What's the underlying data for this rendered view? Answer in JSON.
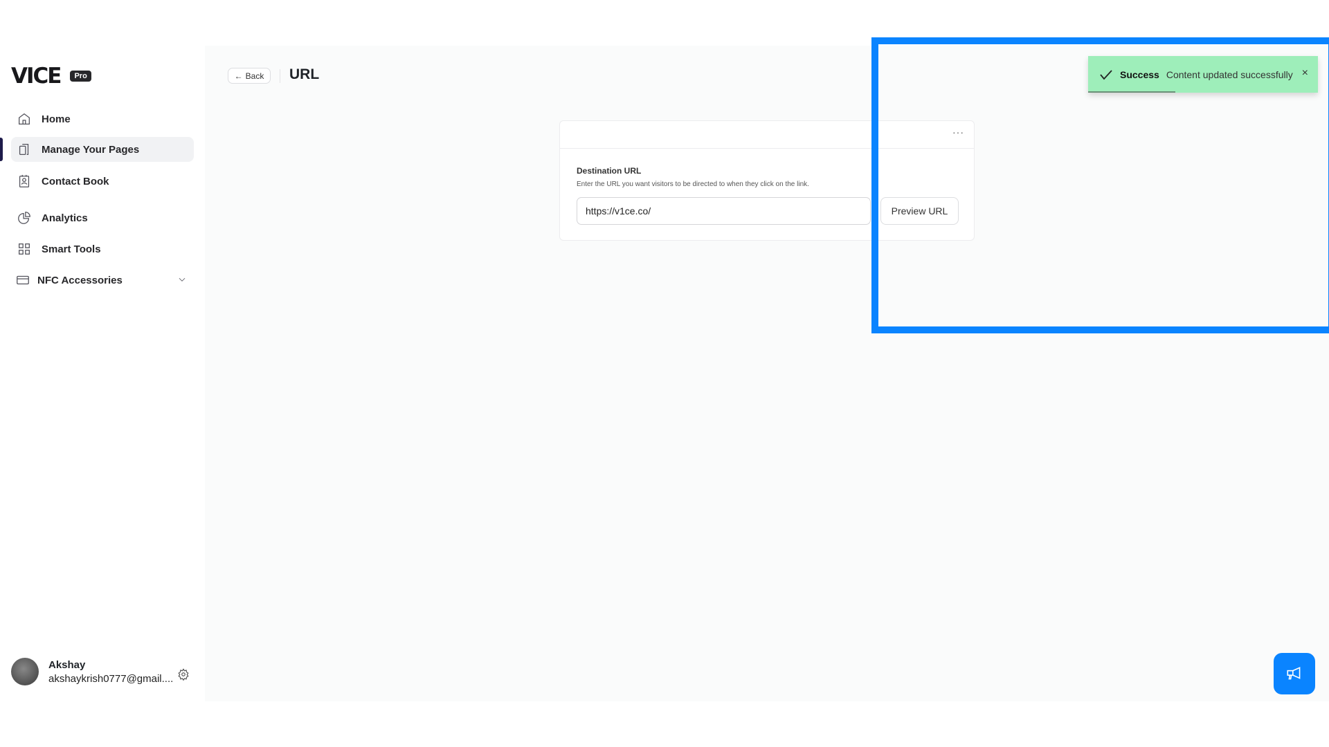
{
  "brand": {
    "logo": "VICE",
    "badge": "Pro"
  },
  "sidebar": {
    "items": [
      {
        "label": "Home",
        "icon": "home-icon"
      },
      {
        "label": "Manage Your Pages",
        "icon": "pages-icon",
        "active": true
      },
      {
        "label": "Contact Book",
        "icon": "contact-book-icon"
      },
      {
        "label": "Analytics",
        "icon": "pie-chart-icon"
      },
      {
        "label": "Smart Tools",
        "icon": "grid-icon"
      },
      {
        "label": "NFC Accessories",
        "icon": "card-icon",
        "expandable": true
      }
    ]
  },
  "user": {
    "name": "Akshay",
    "email": "akshaykrish0777@gmail...."
  },
  "header": {
    "back_label": "Back",
    "title": "URL"
  },
  "card": {
    "menu": "···",
    "label": "Destination URL",
    "description": "Enter the URL you want visitors to be directed to when they click on the link.",
    "url_value": "https://v1ce.co/",
    "preview_label": "Preview URL"
  },
  "toast": {
    "title": "Success",
    "message": "Content updated successfully",
    "close": "×",
    "color": "#9eeeba",
    "progress": 0.38
  },
  "colors": {
    "accent": "#0a84ff",
    "highlight": "#0a84ff"
  }
}
